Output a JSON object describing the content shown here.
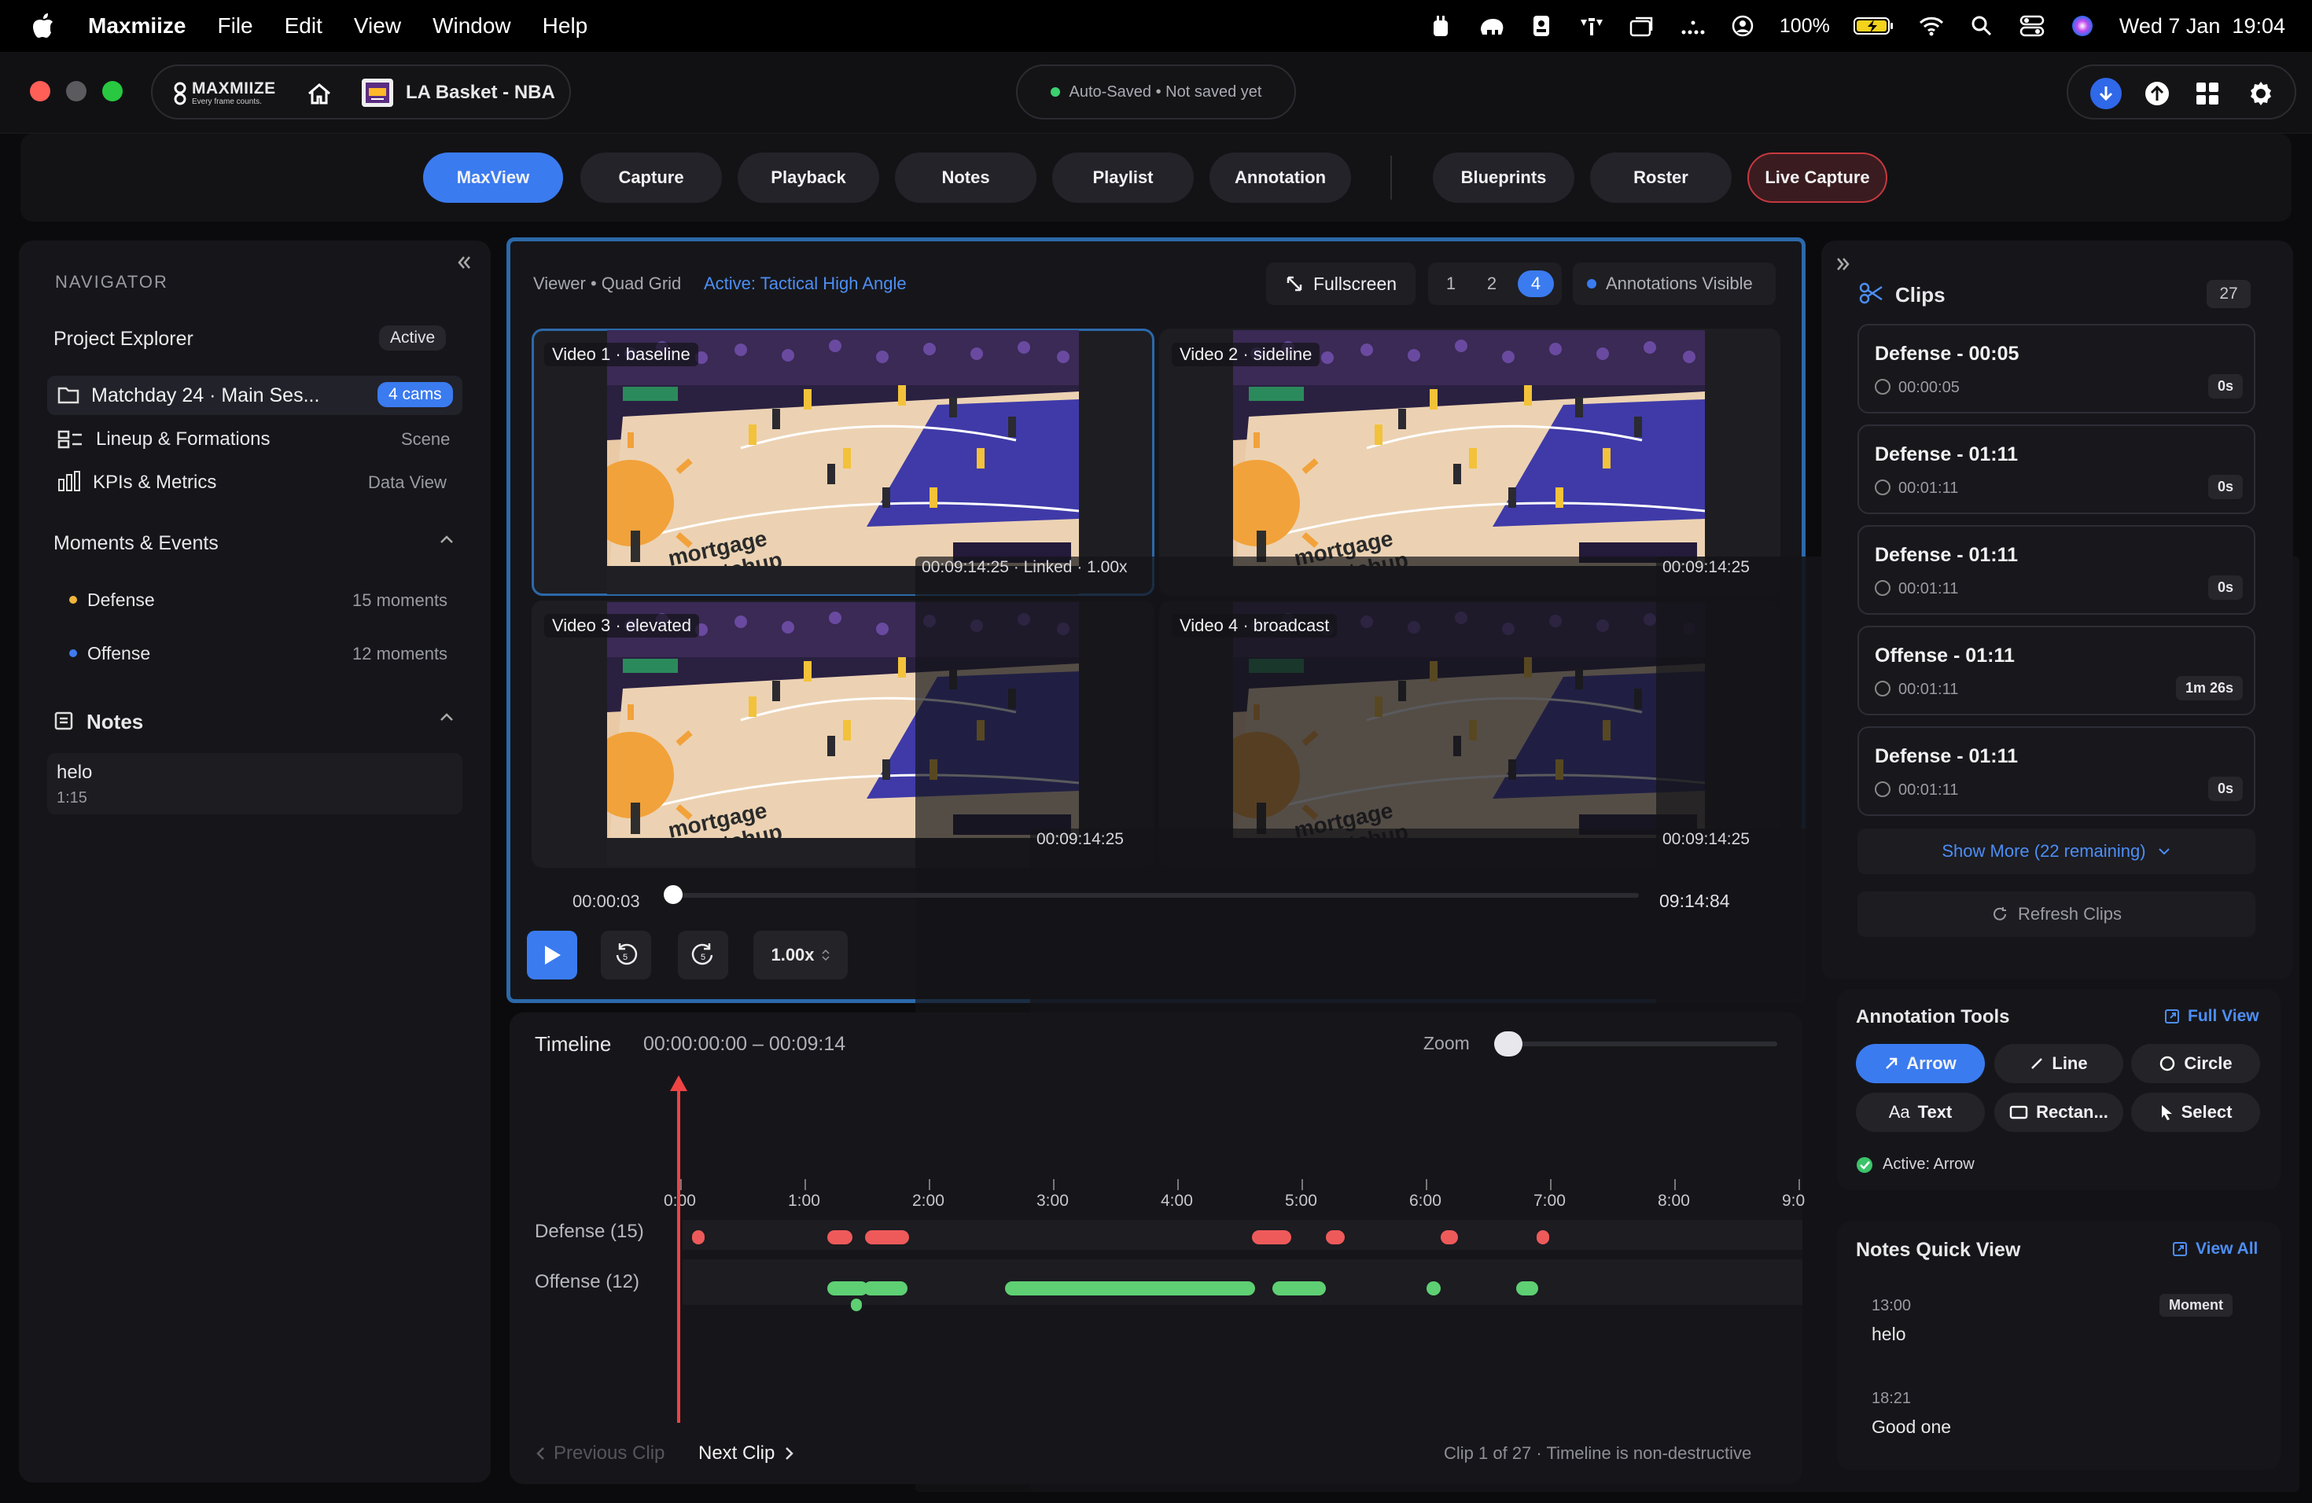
{
  "menubar": {
    "app": "Maxmiize",
    "items": [
      "File",
      "Edit",
      "View",
      "Window",
      "Help"
    ],
    "battery": "100%",
    "datetime": "Wed 7 Jan  19:04"
  },
  "header": {
    "logo_name": "MAXMIIZE",
    "logo_tag": "Every frame counts.",
    "project_title": "LA Basket - NBA",
    "status": "Auto-Saved • Not saved yet"
  },
  "nav": {
    "tabs": [
      "MaxView",
      "Capture",
      "Playback",
      "Notes",
      "Playlist",
      "Annotation"
    ],
    "tabs2": [
      "Blueprints",
      "Roster"
    ],
    "live": "Live Capture"
  },
  "navigator": {
    "heading": "NAVIGATOR",
    "explorer": "Project Explorer",
    "explorer_badge": "Active",
    "items": [
      {
        "label": "Matchday 24 · Main Ses...",
        "meta": "4 cams"
      },
      {
        "label": "Lineup & Formations",
        "meta": "Scene"
      },
      {
        "label": "KPIs & Metrics",
        "meta": "Data View"
      }
    ],
    "moments_heading": "Moments & Events",
    "moments": [
      {
        "label": "Defense",
        "count": "15 moments",
        "color": "#f0b63c"
      },
      {
        "label": "Offense",
        "count": "12 moments",
        "color": "#3f7cf3"
      }
    ],
    "notes_heading": "Notes",
    "note": {
      "text": "helo",
      "time": "1:15"
    }
  },
  "viewer": {
    "label": "Viewer • Quad Grid",
    "active": "Active: Tactical High Angle",
    "fullscreen": "Fullscreen",
    "grid_opts": [
      "1",
      "2",
      "4"
    ],
    "selected_grid": "4",
    "annotations": "Annotations Visible",
    "videos": [
      {
        "label": "Video 1 · baseline",
        "time": "00:09:14:25 · Linked · 1.00x"
      },
      {
        "label": "Video 2 · sideline",
        "time": "00:09:14:25"
      },
      {
        "label": "Video 3 · elevated",
        "time": "00:09:14:25"
      },
      {
        "label": "Video 4 · broadcast",
        "time": "00:09:14:25"
      }
    ],
    "current": "00:00:03",
    "duration": "09:14:84",
    "progress": 0.0,
    "speed": "1.00x",
    "skip_back": "5",
    "skip_fwd": "5"
  },
  "timeline": {
    "title": "Timeline",
    "range": "00:00:00:00 – 00:09:14",
    "zoom_label": "Zoom",
    "zoom": 0.0,
    "ticks": [
      "0:00",
      "1:00",
      "2:00",
      "3:00",
      "4:00",
      "5:00",
      "6:00",
      "7:00",
      "8:00",
      "9:0"
    ],
    "tracks": [
      {
        "label": "Defense (15)",
        "color": "#ee5a5a"
      },
      {
        "label": "Offense (12)",
        "color": "#5fcf73"
      }
    ],
    "prev": "Previous Clip",
    "next": "Next Clip",
    "footer": "Clip 1 of 27 · Timeline is non-destructive"
  },
  "clips": {
    "title": "Clips",
    "count": "27",
    "items": [
      {
        "title": "Defense - 00:05",
        "time": "00:00:05",
        "dur": "0s"
      },
      {
        "title": "Defense - 01:11",
        "time": "00:01:11",
        "dur": "0s"
      },
      {
        "title": "Defense - 01:11",
        "time": "00:01:11",
        "dur": "0s"
      },
      {
        "title": "Offense - 01:11",
        "time": "00:01:11",
        "dur": "1m 26s"
      },
      {
        "title": "Defense - 01:11",
        "time": "00:01:11",
        "dur": "0s"
      }
    ],
    "show_more": "Show More (22 remaining)",
    "refresh": "Refresh Clips"
  },
  "annotation_tools": {
    "title": "Annotation Tools",
    "full_view": "Full View",
    "tools": [
      "Arrow",
      "Line",
      "Circle",
      "Text",
      "Rectan...",
      "Select"
    ],
    "active": "Active: Arrow"
  },
  "notes_quick": {
    "title": "Notes Quick View",
    "view_all": "View All",
    "items": [
      {
        "time": "13:00",
        "tag": "Moment",
        "text": "helo"
      },
      {
        "time": "18:21",
        "tag": "",
        "text": "Good one"
      }
    ]
  }
}
